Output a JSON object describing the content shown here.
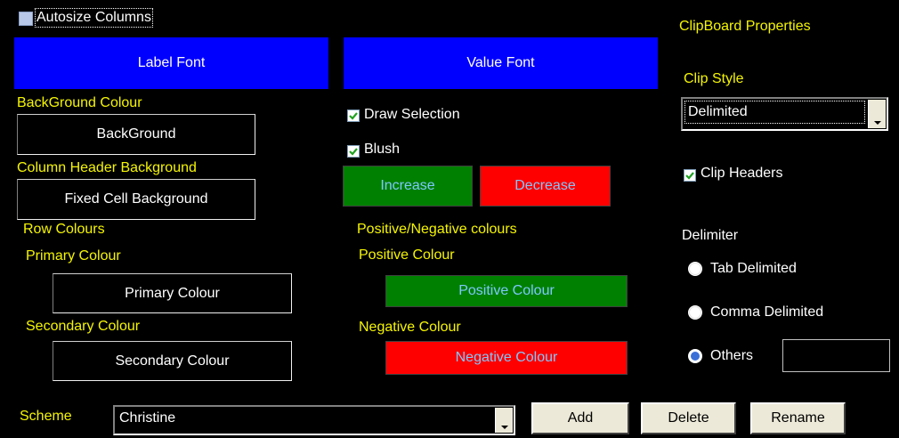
{
  "autosize": {
    "label": "Autosize Columns",
    "checked": false
  },
  "fonts": {
    "label_font": "Label Font",
    "value_font": "Value Font"
  },
  "left": {
    "background_title": "BackGround Colour",
    "background_btn": "BackGround",
    "header_title": "Column Header Background",
    "header_btn": "Fixed Cell Background",
    "row_colours": "Row Colours",
    "primary_title": "Primary Colour",
    "primary_btn": "Primary Colour",
    "secondary_title": "Secondary Colour",
    "secondary_btn": "Secondary Colour"
  },
  "middle": {
    "draw_selection": {
      "label": "Draw Selection",
      "checked": true
    },
    "blush": {
      "label": "Blush",
      "checked": true
    },
    "increase": "Increase",
    "decrease": "Decrease",
    "pos_neg_title": "Positive/Negative colours",
    "positive_title": "Positive Colour",
    "positive_btn": "Positive Colour",
    "negative_title": "Negative Colour",
    "negative_btn": "Negative Colour"
  },
  "right": {
    "clipboard_title": "ClipBoard Properties",
    "clip_style_label": "Clip Style",
    "clip_style_value": "Delimited",
    "clip_headers": {
      "label": "Clip Headers",
      "checked": true
    },
    "delimiter_label": "Delimiter",
    "delimiters": [
      {
        "label": "Tab Delimited",
        "selected": false
      },
      {
        "label": "Comma Delimited",
        "selected": false
      },
      {
        "label": "Others",
        "selected": true
      }
    ],
    "others_value": ""
  },
  "scheme": {
    "label": "Scheme",
    "value": "Christine",
    "add": "Add",
    "delete": "Delete",
    "rename": "Rename"
  },
  "colors": {
    "blue": "#0000ff",
    "green": "#008000",
    "red": "#ff0000",
    "label_yellow": "#f5f500"
  }
}
